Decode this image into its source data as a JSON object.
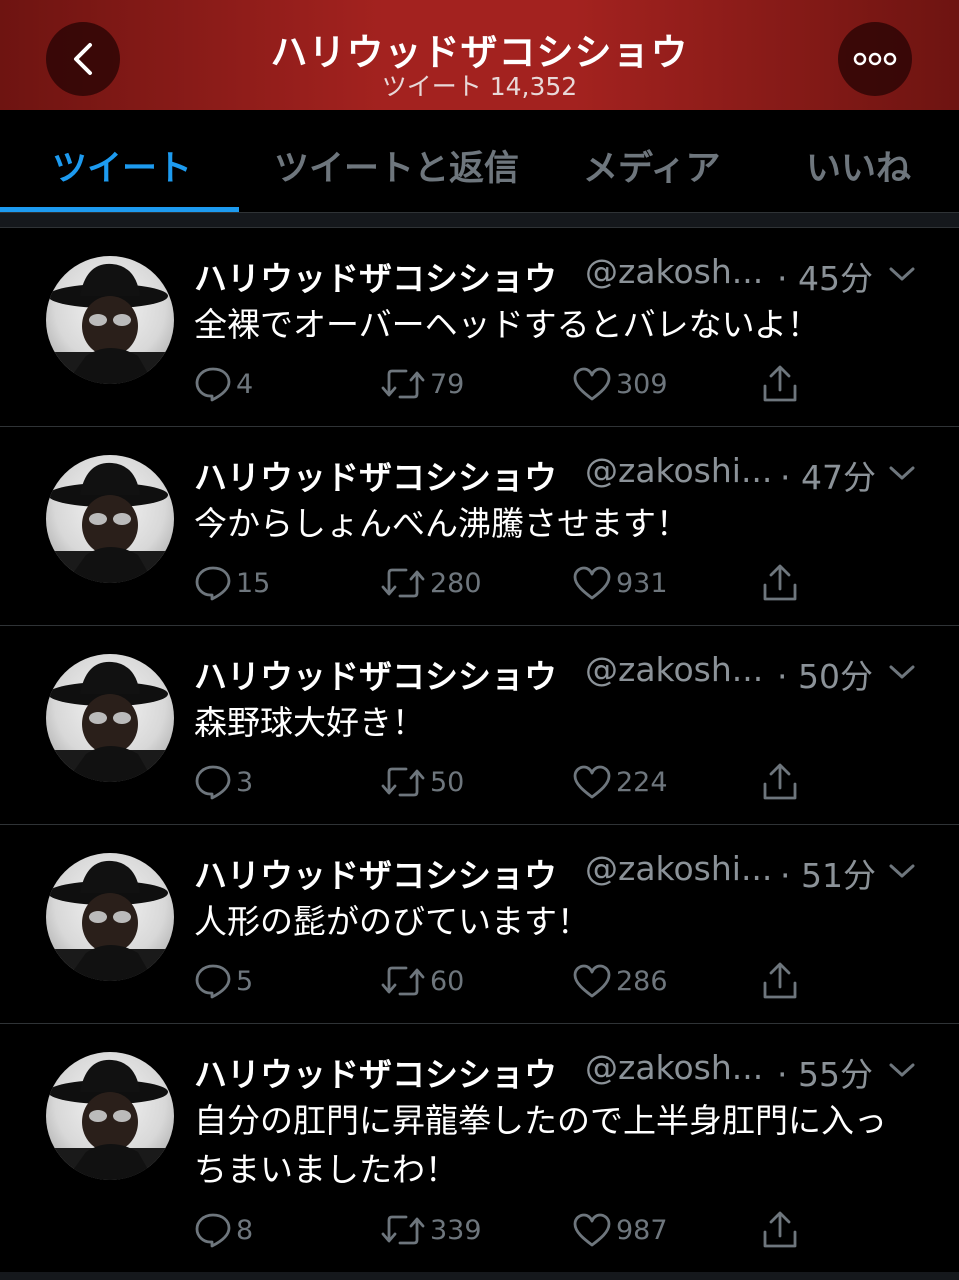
{
  "header": {
    "title": "ハリウッドザコシショウ",
    "subtitle": "ツイート 14,352",
    "back_icon": "chevron-left-icon",
    "more_icon": "more-dots-icon",
    "bg_color": "#a3221f"
  },
  "tabs": [
    {
      "label": "ツイート",
      "active": true
    },
    {
      "label": "ツイートと返信",
      "active": false
    },
    {
      "label": "メディア",
      "active": false
    },
    {
      "label": "いいね",
      "active": false
    }
  ],
  "accent_color": "#1d9bf0",
  "tweets": [
    {
      "name": "ハリウッドザコシショウ",
      "handle": "@zakosh...",
      "time": "· 45分",
      "text": "全裸でオーバーヘッドするとバレないよ！",
      "replies": "4",
      "retweets": "79",
      "likes": "309"
    },
    {
      "name": "ハリウッドザコシショウ",
      "handle": "@zakoshi...",
      "time": "· 47分",
      "text": "今からしょんべん沸騰させます！",
      "replies": "15",
      "retweets": "280",
      "likes": "931"
    },
    {
      "name": "ハリウッドザコシショウ",
      "handle": "@zakosh...",
      "time": "· 50分",
      "text": "森野球大好き！",
      "replies": "3",
      "retweets": "50",
      "likes": "224"
    },
    {
      "name": "ハリウッドザコシショウ",
      "handle": "@zakoshi...",
      "time": "· 51分",
      "text": "人形の髭がのびています！",
      "replies": "5",
      "retweets": "60",
      "likes": "286"
    },
    {
      "name": "ハリウッドザコシショウ",
      "handle": "@zakosh...",
      "time": "· 55分",
      "text": "自分の肛門に昇龍拳したので上半身肛門に入っちまいましたわ！",
      "replies": "8",
      "retweets": "339",
      "likes": "987"
    }
  ]
}
